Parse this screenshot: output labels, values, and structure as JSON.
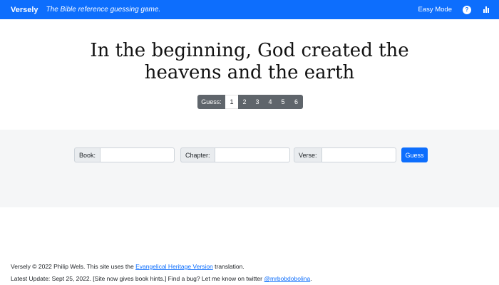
{
  "header": {
    "brand": "Versely",
    "tagline": "The Bible reference guessing game.",
    "easy_mode": "Easy Mode",
    "help_icon": "question-circle-icon",
    "stats_icon": "bar-chart-icon",
    "accent_color": "#0d6efd"
  },
  "verse": {
    "line1": "In the beginning, God created the",
    "line2": "heavens and the earth"
  },
  "guesses": {
    "label": "Guess:",
    "numbers": [
      "1",
      "2",
      "3",
      "4",
      "5",
      "6"
    ],
    "current": 1
  },
  "form": {
    "book_label": "Book:",
    "book_value": "",
    "chapter_label": "Chapter:",
    "chapter_value": "",
    "verse_label": "Verse:",
    "verse_value": "",
    "guess_button": "Guess"
  },
  "footer": {
    "line1_prefix": "Versely © 2022 Philip Wels. This site uses the ",
    "line1_link": "Evangelical Heritage Version",
    "line1_suffix": " translation.",
    "line2_prefix": "Latest Update: Sept 25, 2022. [Site now gives book hints.] Find a bug? Let me know on twitter ",
    "line2_link": "@mrbobdobolina",
    "line2_suffix": "."
  }
}
